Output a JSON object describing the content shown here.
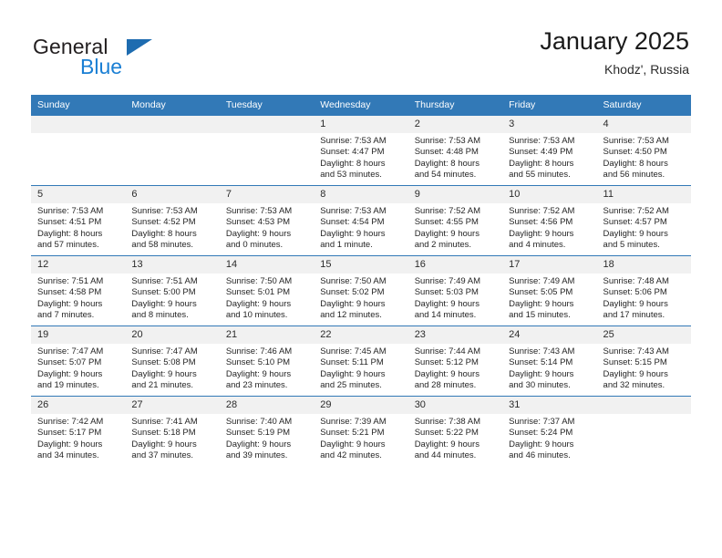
{
  "brand": {
    "name_part1": "General",
    "name_part2": "Blue",
    "logo_icon": "triangle-logo"
  },
  "header": {
    "title": "January 2025",
    "subtitle": "Khodz', Russia"
  },
  "weekday_headers": [
    "Sunday",
    "Monday",
    "Tuesday",
    "Wednesday",
    "Thursday",
    "Friday",
    "Saturday"
  ],
  "colors": {
    "header_blue": "#3279b7",
    "daynum_band": "#f1f1f1",
    "brand_blue": "#1a7fd4",
    "logo_blue": "#1e6cb0",
    "text": "#252525"
  },
  "weeks": [
    [
      {
        "day": "",
        "lines": []
      },
      {
        "day": "",
        "lines": []
      },
      {
        "day": "",
        "lines": []
      },
      {
        "day": "1",
        "lines": [
          "Sunrise: 7:53 AM",
          "Sunset: 4:47 PM",
          "Daylight: 8 hours",
          "and 53 minutes."
        ]
      },
      {
        "day": "2",
        "lines": [
          "Sunrise: 7:53 AM",
          "Sunset: 4:48 PM",
          "Daylight: 8 hours",
          "and 54 minutes."
        ]
      },
      {
        "day": "3",
        "lines": [
          "Sunrise: 7:53 AM",
          "Sunset: 4:49 PM",
          "Daylight: 8 hours",
          "and 55 minutes."
        ]
      },
      {
        "day": "4",
        "lines": [
          "Sunrise: 7:53 AM",
          "Sunset: 4:50 PM",
          "Daylight: 8 hours",
          "and 56 minutes."
        ]
      }
    ],
    [
      {
        "day": "5",
        "lines": [
          "Sunrise: 7:53 AM",
          "Sunset: 4:51 PM",
          "Daylight: 8 hours",
          "and 57 minutes."
        ]
      },
      {
        "day": "6",
        "lines": [
          "Sunrise: 7:53 AM",
          "Sunset: 4:52 PM",
          "Daylight: 8 hours",
          "and 58 minutes."
        ]
      },
      {
        "day": "7",
        "lines": [
          "Sunrise: 7:53 AM",
          "Sunset: 4:53 PM",
          "Daylight: 9 hours",
          "and 0 minutes."
        ]
      },
      {
        "day": "8",
        "lines": [
          "Sunrise: 7:53 AM",
          "Sunset: 4:54 PM",
          "Daylight: 9 hours",
          "and 1 minute."
        ]
      },
      {
        "day": "9",
        "lines": [
          "Sunrise: 7:52 AM",
          "Sunset: 4:55 PM",
          "Daylight: 9 hours",
          "and 2 minutes."
        ]
      },
      {
        "day": "10",
        "lines": [
          "Sunrise: 7:52 AM",
          "Sunset: 4:56 PM",
          "Daylight: 9 hours",
          "and 4 minutes."
        ]
      },
      {
        "day": "11",
        "lines": [
          "Sunrise: 7:52 AM",
          "Sunset: 4:57 PM",
          "Daylight: 9 hours",
          "and 5 minutes."
        ]
      }
    ],
    [
      {
        "day": "12",
        "lines": [
          "Sunrise: 7:51 AM",
          "Sunset: 4:58 PM",
          "Daylight: 9 hours",
          "and 7 minutes."
        ]
      },
      {
        "day": "13",
        "lines": [
          "Sunrise: 7:51 AM",
          "Sunset: 5:00 PM",
          "Daylight: 9 hours",
          "and 8 minutes."
        ]
      },
      {
        "day": "14",
        "lines": [
          "Sunrise: 7:50 AM",
          "Sunset: 5:01 PM",
          "Daylight: 9 hours",
          "and 10 minutes."
        ]
      },
      {
        "day": "15",
        "lines": [
          "Sunrise: 7:50 AM",
          "Sunset: 5:02 PM",
          "Daylight: 9 hours",
          "and 12 minutes."
        ]
      },
      {
        "day": "16",
        "lines": [
          "Sunrise: 7:49 AM",
          "Sunset: 5:03 PM",
          "Daylight: 9 hours",
          "and 14 minutes."
        ]
      },
      {
        "day": "17",
        "lines": [
          "Sunrise: 7:49 AM",
          "Sunset: 5:05 PM",
          "Daylight: 9 hours",
          "and 15 minutes."
        ]
      },
      {
        "day": "18",
        "lines": [
          "Sunrise: 7:48 AM",
          "Sunset: 5:06 PM",
          "Daylight: 9 hours",
          "and 17 minutes."
        ]
      }
    ],
    [
      {
        "day": "19",
        "lines": [
          "Sunrise: 7:47 AM",
          "Sunset: 5:07 PM",
          "Daylight: 9 hours",
          "and 19 minutes."
        ]
      },
      {
        "day": "20",
        "lines": [
          "Sunrise: 7:47 AM",
          "Sunset: 5:08 PM",
          "Daylight: 9 hours",
          "and 21 minutes."
        ]
      },
      {
        "day": "21",
        "lines": [
          "Sunrise: 7:46 AM",
          "Sunset: 5:10 PM",
          "Daylight: 9 hours",
          "and 23 minutes."
        ]
      },
      {
        "day": "22",
        "lines": [
          "Sunrise: 7:45 AM",
          "Sunset: 5:11 PM",
          "Daylight: 9 hours",
          "and 25 minutes."
        ]
      },
      {
        "day": "23",
        "lines": [
          "Sunrise: 7:44 AM",
          "Sunset: 5:12 PM",
          "Daylight: 9 hours",
          "and 28 minutes."
        ]
      },
      {
        "day": "24",
        "lines": [
          "Sunrise: 7:43 AM",
          "Sunset: 5:14 PM",
          "Daylight: 9 hours",
          "and 30 minutes."
        ]
      },
      {
        "day": "25",
        "lines": [
          "Sunrise: 7:43 AM",
          "Sunset: 5:15 PM",
          "Daylight: 9 hours",
          "and 32 minutes."
        ]
      }
    ],
    [
      {
        "day": "26",
        "lines": [
          "Sunrise: 7:42 AM",
          "Sunset: 5:17 PM",
          "Daylight: 9 hours",
          "and 34 minutes."
        ]
      },
      {
        "day": "27",
        "lines": [
          "Sunrise: 7:41 AM",
          "Sunset: 5:18 PM",
          "Daylight: 9 hours",
          "and 37 minutes."
        ]
      },
      {
        "day": "28",
        "lines": [
          "Sunrise: 7:40 AM",
          "Sunset: 5:19 PM",
          "Daylight: 9 hours",
          "and 39 minutes."
        ]
      },
      {
        "day": "29",
        "lines": [
          "Sunrise: 7:39 AM",
          "Sunset: 5:21 PM",
          "Daylight: 9 hours",
          "and 42 minutes."
        ]
      },
      {
        "day": "30",
        "lines": [
          "Sunrise: 7:38 AM",
          "Sunset: 5:22 PM",
          "Daylight: 9 hours",
          "and 44 minutes."
        ]
      },
      {
        "day": "31",
        "lines": [
          "Sunrise: 7:37 AM",
          "Sunset: 5:24 PM",
          "Daylight: 9 hours",
          "and 46 minutes."
        ]
      },
      {
        "day": "",
        "lines": []
      }
    ]
  ]
}
